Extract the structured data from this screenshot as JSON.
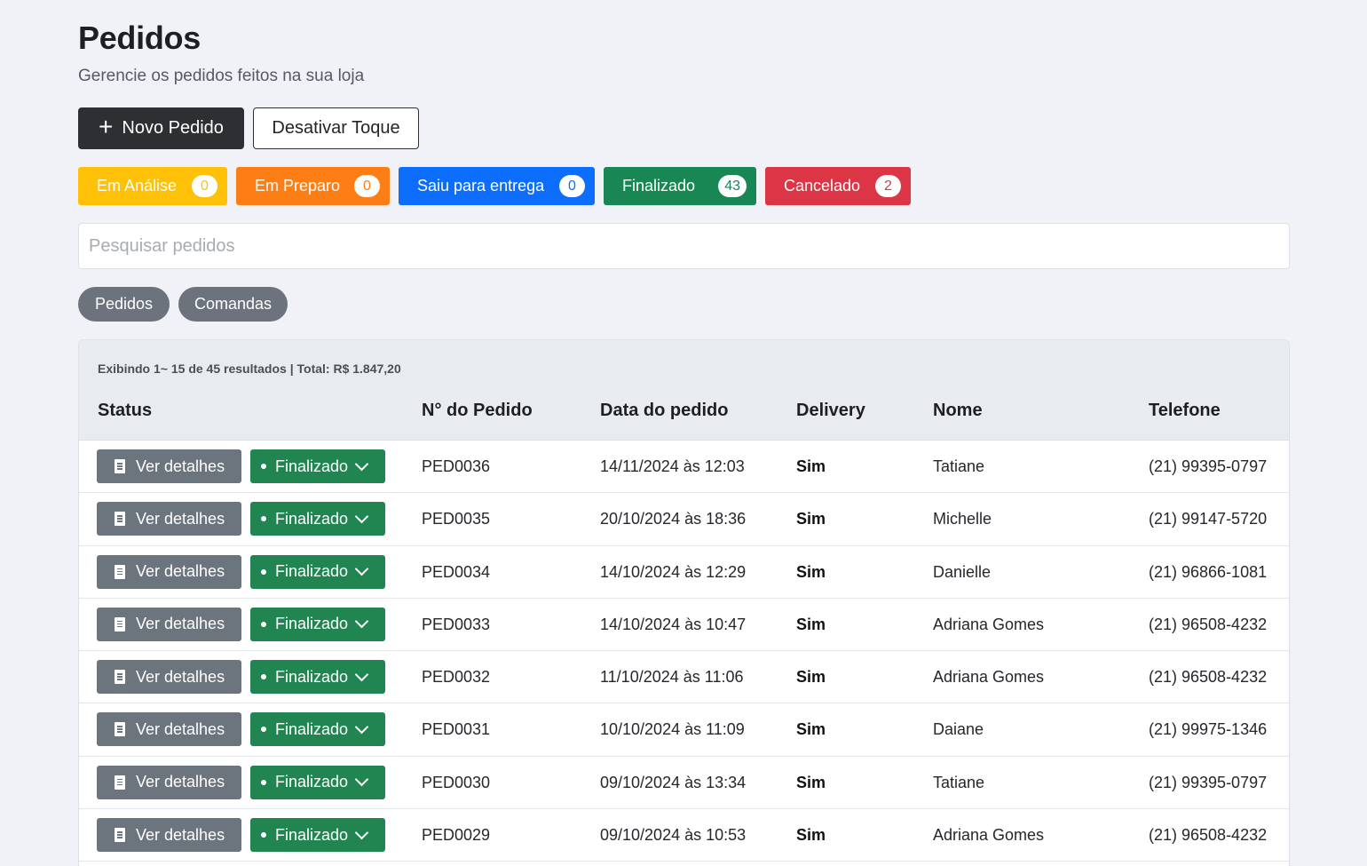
{
  "header": {
    "title": "Pedidos",
    "subtitle": "Gerencie os pedidos feitos na sua loja"
  },
  "actions": {
    "new_order_label": "Novo Pedido",
    "toggle_sound_label": "Desativar Toque"
  },
  "status_filters": [
    {
      "label": "Em Análise",
      "count": "0",
      "color": "#ffc107"
    },
    {
      "label": "Em Preparo",
      "count": "0",
      "color": "#fd7e14"
    },
    {
      "label": "Saiu para entrega",
      "count": "0",
      "color": "#0d6efd"
    },
    {
      "label": "Finalizado",
      "count": "43",
      "color": "#198754"
    },
    {
      "label": "Cancelado",
      "count": "2",
      "color": "#dc3545"
    }
  ],
  "search": {
    "placeholder": "Pesquisar pedidos"
  },
  "view_tabs": [
    "Pedidos",
    "Comandas"
  ],
  "table": {
    "summary": "Exibindo 1~ 15 de 45 resultados | Total: R$ 1.847,20",
    "columns": [
      "Status",
      "N° do Pedido",
      "Data do pedido",
      "Delivery",
      "Nome",
      "Telefone"
    ],
    "details_label": "Ver detalhes",
    "rows": [
      {
        "status": "Finalizado",
        "order": "PED0036",
        "date": "14/11/2024 às 12:03",
        "delivery": "Sim",
        "name": "Tatiane",
        "phone": "(21) 99395-0797"
      },
      {
        "status": "Finalizado",
        "order": "PED0035",
        "date": "20/10/2024 às 18:36",
        "delivery": "Sim",
        "name": "Michelle",
        "phone": "(21) 99147-5720"
      },
      {
        "status": "Finalizado",
        "order": "PED0034",
        "date": "14/10/2024 às 12:29",
        "delivery": "Sim",
        "name": "Danielle",
        "phone": "(21) 96866-1081"
      },
      {
        "status": "Finalizado",
        "order": "PED0033",
        "date": "14/10/2024 às 10:47",
        "delivery": "Sim",
        "name": "Adriana Gomes",
        "phone": "(21) 96508-4232"
      },
      {
        "status": "Finalizado",
        "order": "PED0032",
        "date": "11/10/2024 às 11:06",
        "delivery": "Sim",
        "name": "Adriana Gomes",
        "phone": "(21) 96508-4232"
      },
      {
        "status": "Finalizado",
        "order": "PED0031",
        "date": "10/10/2024 às 11:09",
        "delivery": "Sim",
        "name": "Daiane",
        "phone": "(21) 99975-1346"
      },
      {
        "status": "Finalizado",
        "order": "PED0030",
        "date": "09/10/2024 às 13:34",
        "delivery": "Sim",
        "name": "Tatiane",
        "phone": "(21) 99395-0797"
      },
      {
        "status": "Finalizado",
        "order": "PED0029",
        "date": "09/10/2024 às 10:53",
        "delivery": "Sim",
        "name": "Adriana Gomes",
        "phone": "(21) 96508-4232"
      }
    ]
  }
}
